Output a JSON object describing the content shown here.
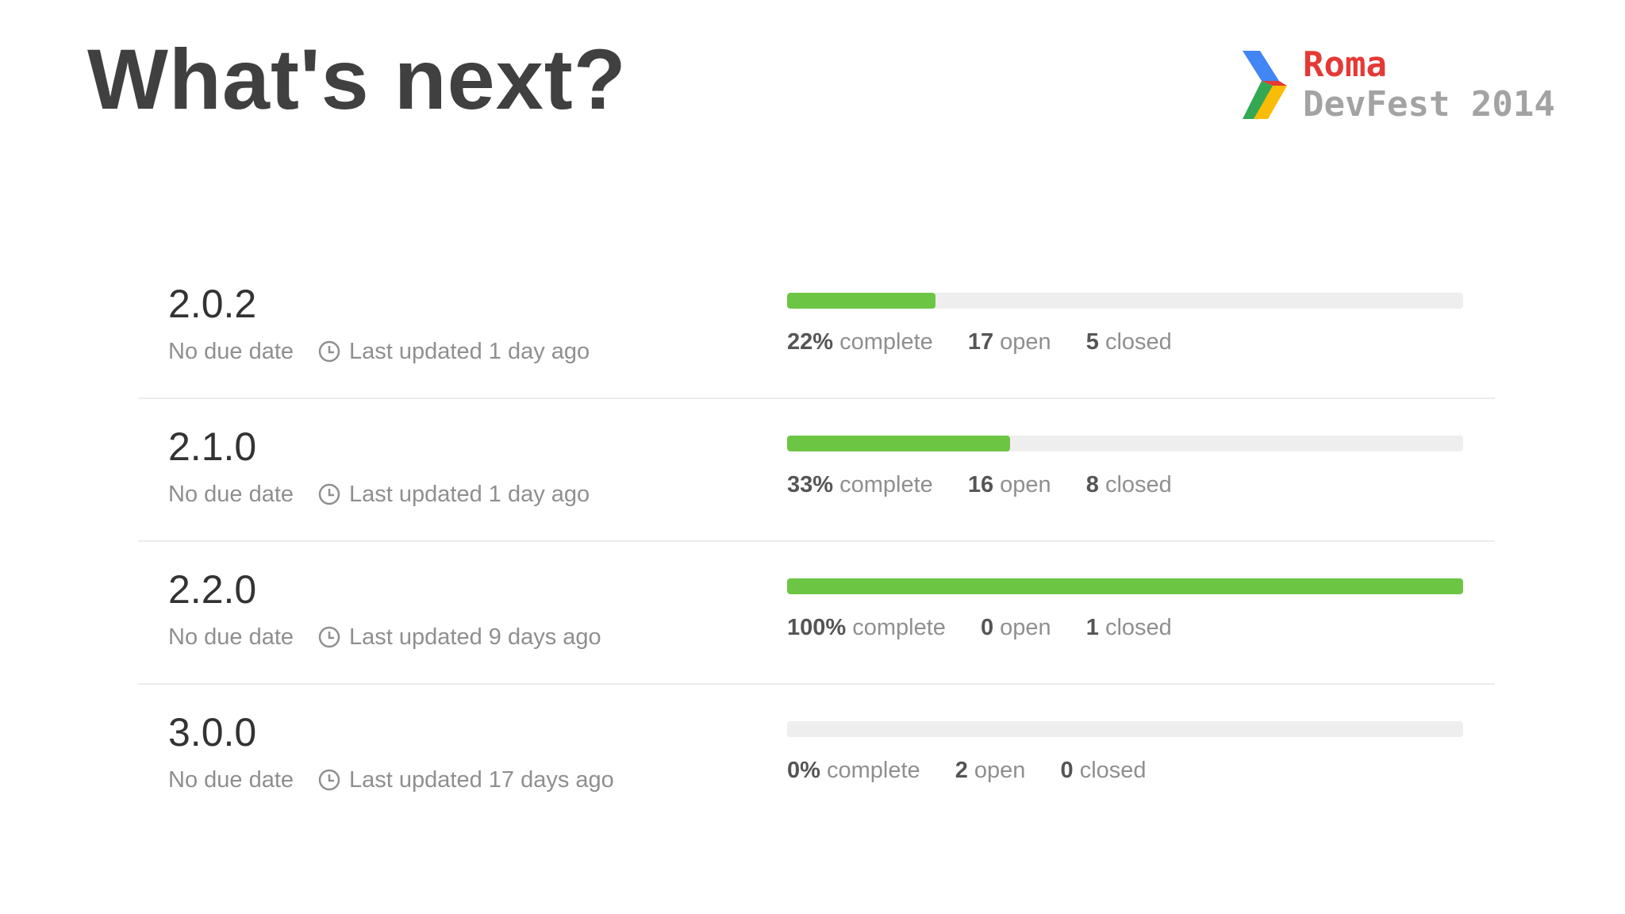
{
  "slide": {
    "title": "What's next?"
  },
  "logo": {
    "city": "Roma",
    "event": "DevFest 2014",
    "colors": {
      "red": "#e53935",
      "blue": "#4285f4",
      "green": "#34a853",
      "yellow": "#fbbc05"
    }
  },
  "labels": {
    "no_due_date": "No due date",
    "complete_suffix": "complete",
    "open_suffix": "open",
    "closed_suffix": "closed"
  },
  "accent_color": "#6cc644",
  "milestones": [
    {
      "title": "2.0.2",
      "updated": "Last updated 1 day ago",
      "percent_label": "22%",
      "open_count": "17",
      "closed_count": "5",
      "progress_fraction": 0.22
    },
    {
      "title": "2.1.0",
      "updated": "Last updated 1 day ago",
      "percent_label": "33%",
      "open_count": "16",
      "closed_count": "8",
      "progress_fraction": 0.33
    },
    {
      "title": "2.2.0",
      "updated": "Last updated 9 days ago",
      "percent_label": "100%",
      "open_count": "0",
      "closed_count": "1",
      "progress_fraction": 1.0
    },
    {
      "title": "3.0.0",
      "updated": "Last updated 17 days ago",
      "percent_label": "0%",
      "open_count": "2",
      "closed_count": "0",
      "progress_fraction": 0
    }
  ]
}
